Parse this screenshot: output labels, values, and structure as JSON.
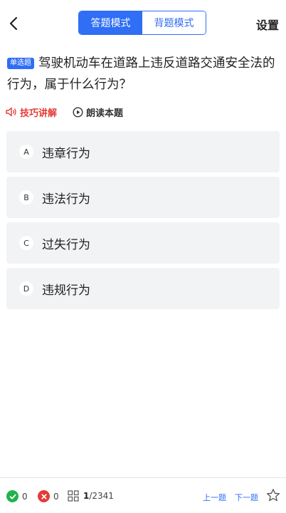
{
  "header": {
    "mode_tabs": [
      {
        "label": "答题模式",
        "active": true
      },
      {
        "label": "背题模式",
        "active": false
      }
    ],
    "settings_label": "设置"
  },
  "question": {
    "type_tag": "单选题",
    "text": "驾驶机动车在道路上违反道路交通安全法的行为，属于什么行为？"
  },
  "tools": {
    "skill_label": "技巧讲解",
    "read_label": "朗读本题"
  },
  "options": [
    {
      "letter": "A",
      "text": "违章行为"
    },
    {
      "letter": "B",
      "text": "违法行为"
    },
    {
      "letter": "C",
      "text": "过失行为"
    },
    {
      "letter": "D",
      "text": "违规行为"
    }
  ],
  "footer": {
    "correct_count": "0",
    "wrong_count": "0",
    "current": "1",
    "total": "/2341",
    "prev_label": "上一题",
    "next_label": "下一题"
  },
  "colors": {
    "accent": "#2f6ef5",
    "danger": "#e53935",
    "success": "#22b24c",
    "option_bg": "#f2f3f5"
  },
  "icons": [
    "back-arrow-icon",
    "speaker-icon",
    "play-circle-icon",
    "check-icon",
    "cross-icon",
    "grid-icon",
    "star-icon"
  ]
}
